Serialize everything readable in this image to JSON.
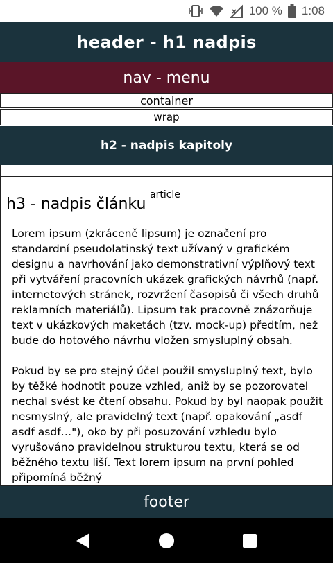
{
  "status_bar": {
    "battery_percent": "100 %",
    "time": "1:08",
    "icons": [
      "vibrate-icon",
      "wifi-icon",
      "signal-icon",
      "battery-icon"
    ]
  },
  "header": {
    "title": "header - h1 nadpis"
  },
  "nav": {
    "label": "nav - menu"
  },
  "container": {
    "label": "container"
  },
  "wrap": {
    "label": "wrap"
  },
  "section": {
    "h2": "h2 - nadpis kapitoly"
  },
  "article": {
    "tag": "article",
    "h3": "h3 - nadpis článku",
    "paragraphs": [
      "Lorem ipsum (zkráceně lipsum) je označení pro standardní pseudolatinský text užívaný v grafickém designu a navrhování jako demonstrativní výplňový text při vytváření pracovních ukázek grafických návrhů (např. internetových stránek, rozvržení časopisů či všech druhů reklamních materiálů). Lipsum tak pracovně znázorňuje text v ukázkových maketách (tzv. mock-up) předtím, než bude do hotového návrhu vložen smysluplný obsah.",
      "Pokud by se pro stejný účel použil smysluplný text, bylo by těžké hodnotit pouze vzhled, aniž by se pozorovatel nechal svést ke čtení obsahu. Pokud by byl naopak použit nesmyslný, ale pravidelný text (např. opakování „asdf asdf asdf…\"), oko by při posuzování vzhledu bylo vyrušováno pravidelnou strukturou textu, která se od běžného textu liší. Text lorem ipsum na první pohled připomíná běžný"
    ]
  },
  "footer": {
    "label": "footer"
  },
  "colors": {
    "dark_teal": "#1b333d",
    "maroon": "#5a1528"
  },
  "nav_bar": {
    "icons": [
      "back-icon",
      "home-icon",
      "recents-icon"
    ]
  }
}
